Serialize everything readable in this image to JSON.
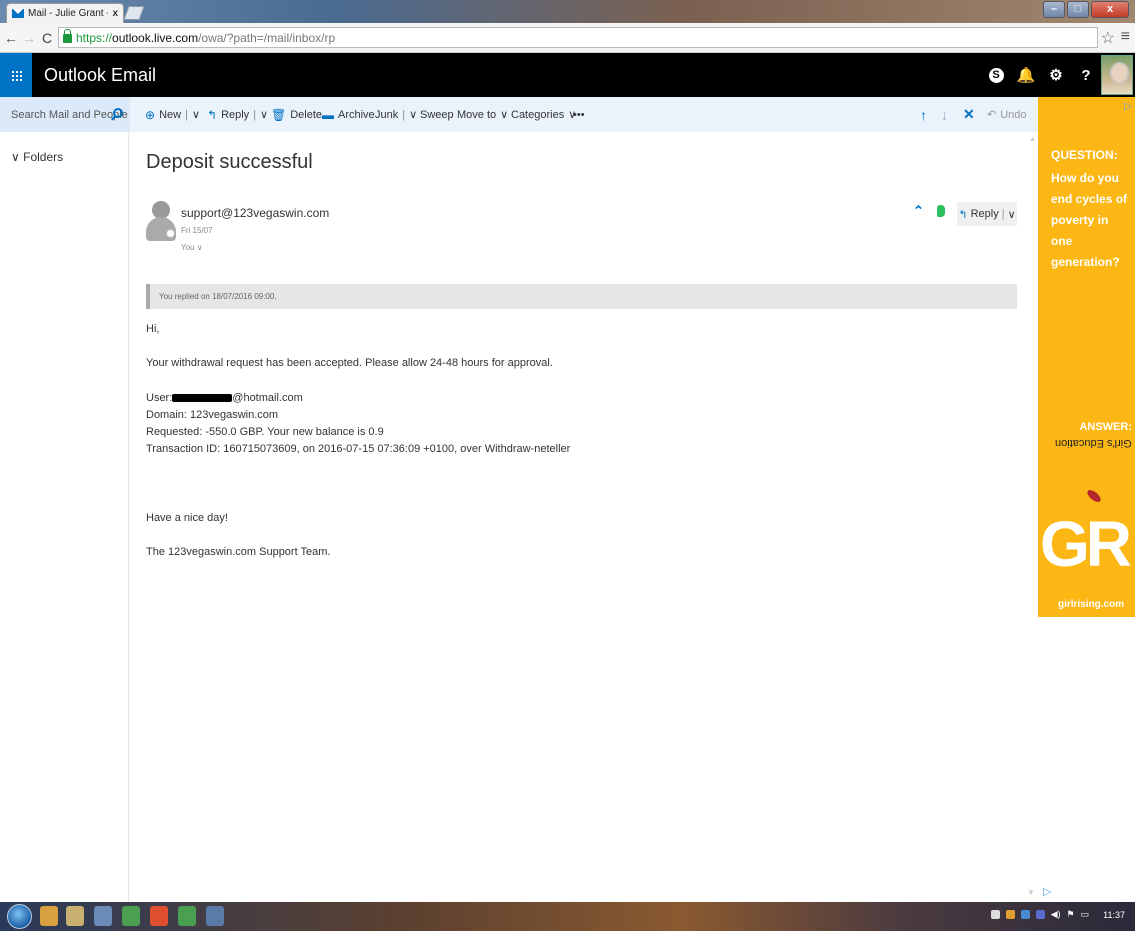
{
  "browser": {
    "tab_title": "Mail - Julie Grant - Outlo",
    "tab_close": "x",
    "url_scheme": "https://",
    "url_host": "outlook.live.com",
    "url_path": "/owa/?path=/mail/inbox/rp"
  },
  "header": {
    "title": "Outlook Email",
    "icons": [
      "skype-icon",
      "bell-icon",
      "gear-icon",
      "help-icon"
    ],
    "skype_glyph": "S",
    "bell_glyph": "🔔",
    "gear_glyph": "⚙",
    "help_glyph": "?"
  },
  "search": {
    "placeholder": "Search Mail and People"
  },
  "commands": {
    "new": "New",
    "reply": "Reply",
    "delete": "Delete",
    "archive": "Archive",
    "junk": "Junk",
    "sweep": "Sweep",
    "move_to": "Move to",
    "categories": "Categories",
    "more": "•••",
    "undo": "Undo"
  },
  "sidebar": {
    "folders_label": "Folders"
  },
  "message": {
    "subject": "Deposit successful",
    "sender": "support@123vegaswin.com",
    "date": "Fri 15/07",
    "to": "You",
    "reply_label": "Reply",
    "replied_notice": "You replied on 18/07/2016 09:00.",
    "greeting": "Hi,",
    "line1": "Your withdrawal request has been accepted. Please allow 24-48 hours for approval.",
    "user_prefix": "User:",
    "user_suffix": "@hotmail.com",
    "domain": "Domain: 123vegaswin.com",
    "requested": "Requested: -550.0 GBP. Your new balance is 0.9",
    "transaction": "Transaction ID: 160715073609, on 2016-07-15 07:36:09 +0100, over Withdraw-neteller",
    "closing": "Have a nice day!",
    "signature": "The 123vegaswin.com Support Team."
  },
  "ad": {
    "question_label": "QUESTION:",
    "question_text": "How do you end cycles of poverty in one generation?",
    "answer_label": "ANSWER:",
    "answer_text": "Girl's Education",
    "logo": "GR",
    "url": "girlrising.com"
  },
  "taskbar": {
    "clock": "11:37"
  },
  "colors": {
    "accent": "#0072c6",
    "ad_bg": "#fcb714",
    "header_bg": "#000000"
  }
}
